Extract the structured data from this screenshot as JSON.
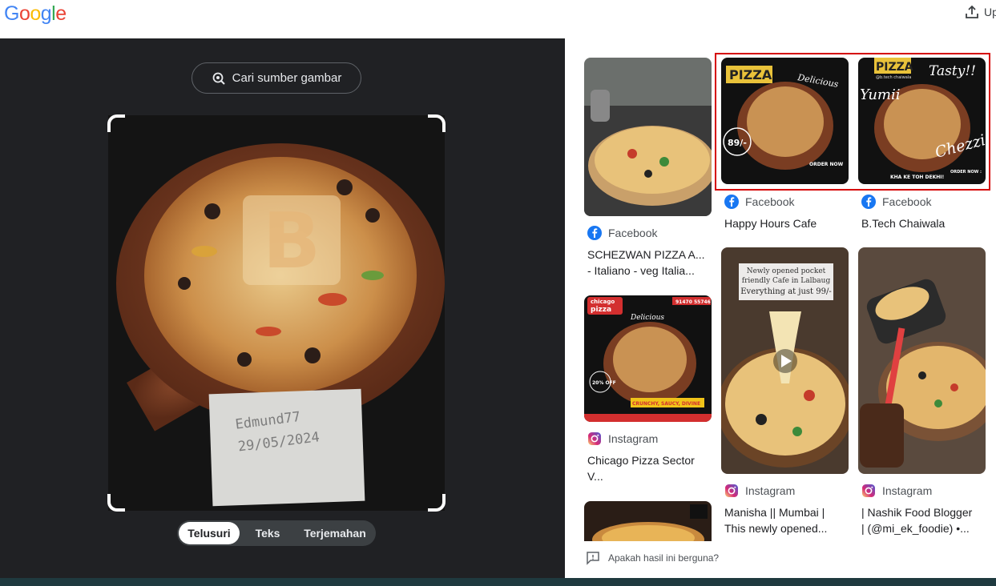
{
  "header": {
    "logo_letters": [
      "G",
      "o",
      "o",
      "g",
      "l",
      "e"
    ],
    "logo_colors": [
      "#4285F4",
      "#EA4335",
      "#FBBC05",
      "#4285F4",
      "#34A853",
      "#EA4335"
    ],
    "upload_label": "Up"
  },
  "lens": {
    "search_source_label": "Cari sumber gambar",
    "note_text_line1": "Edmund77",
    "note_text_line2": "29/05/2024",
    "modes": [
      "Telusuri",
      "Teks",
      "Terjemahan"
    ],
    "active_mode": "Telusuri"
  },
  "results": [
    {
      "source": "Facebook",
      "source_icon": "facebook-icon",
      "title_line1": "SCHEZWAN PIZZA A...",
      "title_line2": "- Italiano - veg Italia..."
    },
    {
      "source": "Facebook",
      "source_icon": "facebook-icon",
      "title_line1": "Happy Hours Cafe",
      "title_line2": "",
      "thumb_text": "PIZZA",
      "thumb_script": "Delicious",
      "thumb_price": "89/-",
      "thumb_order": "ORDER NOW"
    },
    {
      "source": "Facebook",
      "source_icon": "facebook-icon",
      "title_line1": "B.Tech Chaiwala",
      "title_line2": "",
      "thumb_text": "PIZZA",
      "thumb_handle": "@b.tech chaiwala",
      "thumb_tasty": "Tasty!!",
      "thumb_yumii": "Yumii",
      "thumb_chezzi": "Chezzi",
      "thumb_caption": "KHA KE TOH DEKHI!",
      "thumb_order": "ORDER NOW :"
    },
    {
      "source": "Instagram",
      "source_icon": "instagram-icon",
      "title_line1": "Chicago Pizza Sector",
      "title_line2": "V...",
      "thumb_brand_top": "chicago",
      "thumb_brand": "pizza",
      "thumb_script": "Delicious",
      "thumb_phone": "91470 55746",
      "thumb_off": "20% OFF",
      "thumb_tagline": "CRUNCHY, SAUCY, DIVINE"
    },
    {
      "source": "Instagram",
      "source_icon": "instagram-icon",
      "title_line1": "Manisha || Mumbai |",
      "title_line2": "This newly opened...",
      "thumb_banner1": "Newly opened pocket",
      "thumb_banner2": "friendly Cafe in Lalbaug",
      "thumb_banner3": "Everything at just 99/-"
    },
    {
      "source": "Instagram",
      "source_icon": "instagram-icon",
      "title_line1": "| Nashik Food Blogger",
      "title_line2": "| (@mi_ek_foodie) •..."
    }
  ],
  "feedback_label": "Apakah hasil ini berguna?",
  "colors": {
    "dark_bg": "#202124",
    "highlight": "#d50000",
    "facebook": "#1877F2"
  }
}
